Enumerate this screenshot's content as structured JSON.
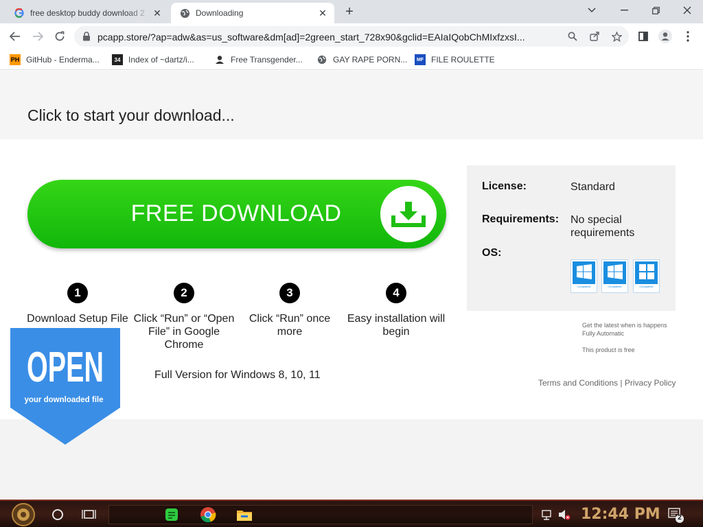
{
  "browser": {
    "tabs": [
      {
        "title": "free desktop buddy download 2",
        "icon": "google-g-icon"
      },
      {
        "title": "Downloading",
        "icon": "globe-icon"
      }
    ],
    "url": "pcapp.store/?ap=adw&as=us_software&dm[ad]=2green_start_728x90&gclid=EAIaIQobChMIxfzxsI...",
    "bookmarks": [
      {
        "label": "GitHub - Enderma...",
        "icon": "ph-icon"
      },
      {
        "label": "Index of ~dartz/i...",
        "icon": "tile-icon"
      },
      {
        "label": "Free Transgender...",
        "icon": "user-icon"
      },
      {
        "label": "GAY RAPE PORN...",
        "icon": "globe-icon"
      },
      {
        "label": "FILE ROULETTE",
        "icon": "file-icon"
      }
    ]
  },
  "page": {
    "headline": "Click to start your download...",
    "download_button": "FREE DOWNLOAD",
    "steps": [
      {
        "num": "1",
        "text": "Download Setup File"
      },
      {
        "num": "2",
        "text": "Click “Run” or “Open File” in Google Chrome"
      },
      {
        "num": "3",
        "text": "Click “Run” once more"
      },
      {
        "num": "4",
        "text": "Easy installation will begin"
      }
    ],
    "full_version": "Full Version for Windows 8, 10, 11",
    "info": {
      "license_label": "License:",
      "license_value": "Standard",
      "requirements_label": "Requirements:",
      "requirements_value": "No special requirements",
      "os_label": "OS:",
      "os_badges": [
        {
          "name": "Windows 8",
          "caption": "Compatible"
        },
        {
          "name": "Windows 10",
          "caption": "Compatible"
        },
        {
          "name": "Windows 11",
          "caption": "Compatible"
        }
      ]
    },
    "note1": "Get the latest when is happens",
    "note2": "Fully Automatic",
    "note3": "This product is free",
    "terms": "Terms and Conditions",
    "separator": "|",
    "privacy": "Privacy Policy",
    "open_banner": {
      "title": "OPEN",
      "subtitle": "your downloaded file",
      "color": "#3a8ee6"
    },
    "accent_green": "#19c20e"
  },
  "taskbar": {
    "clock": "12:44 PM",
    "notification_count": "2"
  }
}
